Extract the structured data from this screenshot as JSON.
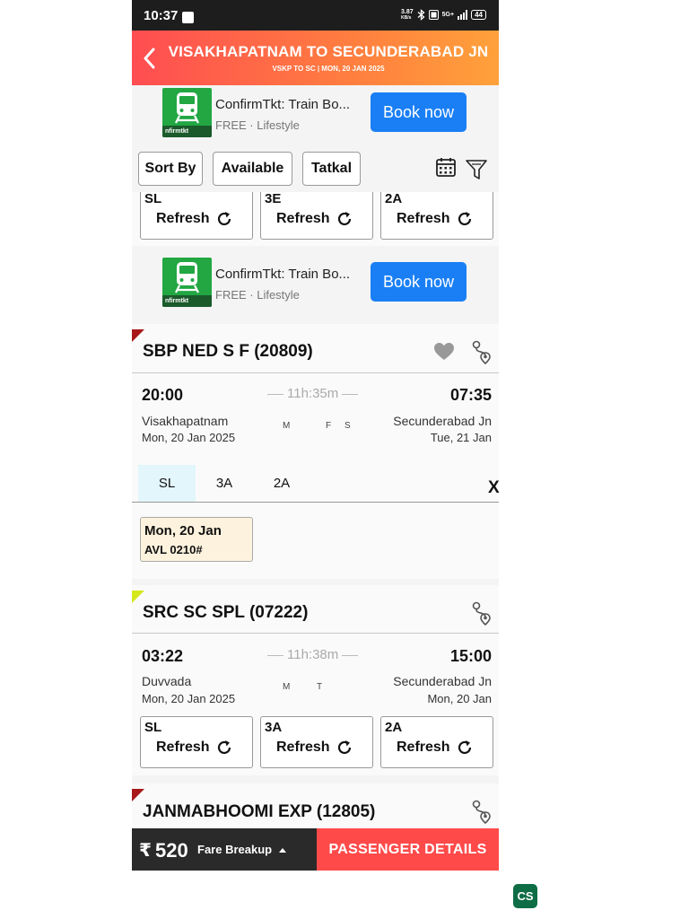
{
  "status_bar": {
    "time": "10:37",
    "net_speed": "3.87",
    "net_unit": "KB/s",
    "network": "5G+",
    "battery": "44"
  },
  "header": {
    "title": "VISAKHAPATNAM TO SECUNDERABAD JN",
    "subtitle": "VSKP TO SC | MON, 20 JAN 2025"
  },
  "ads": [
    {
      "title": "ConfirmTkt: Train Bo...",
      "subtitle": "FREE · Lifestyle",
      "cta": "Book now",
      "logo_text": "nfirmtkt"
    },
    {
      "title": "ConfirmTkt: Train Bo...",
      "subtitle": "FREE · Lifestyle",
      "cta": "Book now",
      "logo_text": "nfirmtkt"
    }
  ],
  "filters": {
    "sort_by": "Sort By",
    "available": "Available",
    "tatkal": "Tatkal"
  },
  "top_classes": [
    {
      "label": "SL",
      "action": "Refresh"
    },
    {
      "label": "3E",
      "action": "Refresh"
    },
    {
      "label": "2A",
      "action": "Refresh"
    }
  ],
  "trains": [
    {
      "name": "SBP NED S F (20809)",
      "ribbon_color": "#a81818",
      "dep_time": "20:00",
      "arr_time": "07:35",
      "duration": "11h:35m",
      "from": "Visakhapatnam",
      "from_date": "Mon, 20 Jan  2025",
      "to": "Secunderabad Jn",
      "to_date": "Tue, 21 Jan",
      "days": [
        "M",
        "F",
        "S"
      ],
      "class_tabs": [
        "SL",
        "3A",
        "2A"
      ],
      "selected_class": "SL",
      "close": "X",
      "availability": {
        "date": "Mon, 20 Jan",
        "status": "AVL 0210#"
      }
    },
    {
      "name": "SRC SC SPL (07222)",
      "ribbon_color": "#d4e81a",
      "dep_time": "03:22",
      "arr_time": "15:00",
      "duration": "11h:38m",
      "from": "Duvvada",
      "from_date": "Mon, 20 Jan  2025",
      "to": "Secunderabad Jn",
      "to_date": "Mon, 20 Jan",
      "days": [
        "M",
        "T"
      ],
      "classes": [
        {
          "label": "SL",
          "action": "Refresh"
        },
        {
          "label": "3A",
          "action": "Refresh"
        },
        {
          "label": "2A",
          "action": "Refresh"
        }
      ]
    },
    {
      "name": "JANMABHOOMI EXP (12805)",
      "ribbon_color": "#a81818"
    }
  ],
  "bottom_bar": {
    "currency": "₹",
    "fare": "520",
    "fare_breakup": "Fare Breakup",
    "cta": "PASSENGER DETAILS"
  },
  "watermark": "CS"
}
